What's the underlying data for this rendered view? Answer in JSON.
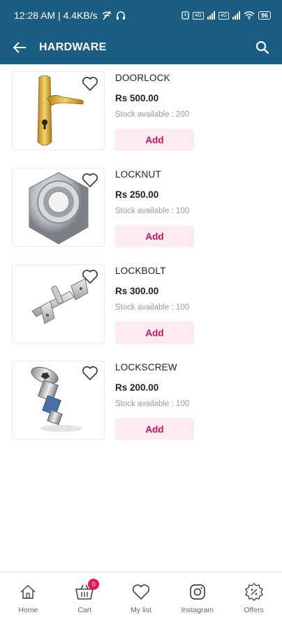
{
  "status_bar": {
    "time_speed": "12:28 AM | 4.4KB/s",
    "net_badge_1": "4G",
    "net_badge_2": "4G",
    "battery": "96"
  },
  "app_bar": {
    "title": "HARDWARE"
  },
  "products": [
    {
      "name": "DOORLOCK",
      "price": "Rs 500.00",
      "stock": "Stock available : 200",
      "add_label": "Add"
    },
    {
      "name": "LOCKNUT",
      "price": "Rs 250.00",
      "stock": "Stock available : 100",
      "add_label": "Add"
    },
    {
      "name": "LOCKBOLT",
      "price": "Rs 300.00",
      "stock": "Stock available : 100",
      "add_label": "Add"
    },
    {
      "name": "LOCKSCREW",
      "price": "Rs 200.00",
      "stock": "Stock available : 100",
      "add_label": "Add"
    }
  ],
  "bottom_nav": {
    "items": [
      {
        "label": "Home",
        "icon": "home-icon"
      },
      {
        "label": "Cart",
        "icon": "cart-icon",
        "badge": "0"
      },
      {
        "label": "My list",
        "icon": "heart-icon"
      },
      {
        "label": "Instagram",
        "icon": "instagram-icon"
      },
      {
        "label": "Offers",
        "icon": "offers-icon"
      }
    ]
  },
  "colors": {
    "header": "#1b5d82",
    "add_button_bg": "#fdebf2",
    "add_button_text": "#d0105c",
    "badge": "#e8155d"
  }
}
